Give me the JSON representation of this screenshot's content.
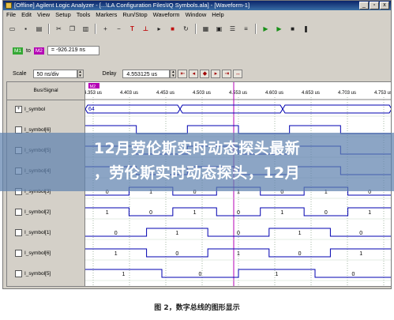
{
  "window": {
    "title": "[Offline] Agilent Logic Analyzer - [...\\LA Configuration Files\\IQ Symbols.ala] - [Waveform-1]",
    "controls": [
      "_",
      "▫",
      "x"
    ]
  },
  "menu": [
    "File",
    "Edit",
    "View",
    "Setup",
    "Tools",
    "Markers",
    "Run/Stop",
    "Waveform",
    "Window",
    "Help"
  ],
  "toolbar_icons": [
    "open-icon",
    "save-icon",
    "print-icon",
    "cut-icon",
    "copy-icon",
    "paste-icon",
    "zoom-in-icon",
    "zoom-out-icon",
    "find-icon",
    "marker-icon",
    "run-icon",
    "stop-icon",
    "run-repeat-icon",
    "grid-icon",
    "group-icon",
    "list-icon",
    "trace-icon",
    "play-icon",
    "play-repeat-icon",
    "stop-square-icon",
    "pause-icon"
  ],
  "markers": {
    "m1_label": "M1",
    "to_label": "to",
    "m2_label": "M2",
    "delta_value": "= -926.219 ns"
  },
  "controls": {
    "scale_label": "Scale",
    "scale_value": "50 ns/div",
    "delay_label": "Delay",
    "delay_value": "4.553125 us"
  },
  "waveform": {
    "header": "Bus/Signal",
    "marker_tag": "M2",
    "time_ticks": [
      "4.353 us",
      "4.403 us",
      "4.453 us",
      "4.503 us",
      "4.553 us",
      "4.603 us",
      "4.653 us",
      "4.703 us",
      "4.753 us"
    ],
    "signals": [
      {
        "name": "I_symbol",
        "bus": true,
        "values": [
          "64"
        ]
      },
      {
        "name": "I_symbol[6]",
        "bus": false,
        "values": []
      },
      {
        "name": "I_symbol[5]",
        "bus": false,
        "values": []
      },
      {
        "name": "I_symbol[4]",
        "bus": false,
        "values": []
      },
      {
        "name": "I_symbol[3]",
        "bus": false,
        "values": [
          "0",
          "1",
          "0",
          "1",
          "0",
          "1",
          "0"
        ]
      },
      {
        "name": "I_symbol[2]",
        "bus": false,
        "values": [
          "1",
          "0",
          "1",
          "0",
          "1",
          "0",
          "1"
        ]
      },
      {
        "name": "I_symbol[1]",
        "bus": false,
        "values": [
          "0",
          "1",
          "0",
          "1",
          "0"
        ]
      },
      {
        "name": "I_symbol[6]",
        "bus": false,
        "values": [
          "1",
          "0",
          "1",
          "0",
          "1"
        ]
      },
      {
        "name": "I_symbol[5]",
        "bus": false,
        "values": [
          "1",
          "0",
          "1",
          "0"
        ]
      }
    ]
  },
  "overlay": {
    "line1": "12月劳伦斯实时动态探头最新",
    "line2": "，劳伦斯实时动态探头，12月"
  },
  "caption": "图 2，数字总线的图形显示",
  "colors": {
    "grid": "#6a8a6a",
    "trace": "#0000b0",
    "marker": "#b400b4",
    "overlay": "#5f82af"
  }
}
